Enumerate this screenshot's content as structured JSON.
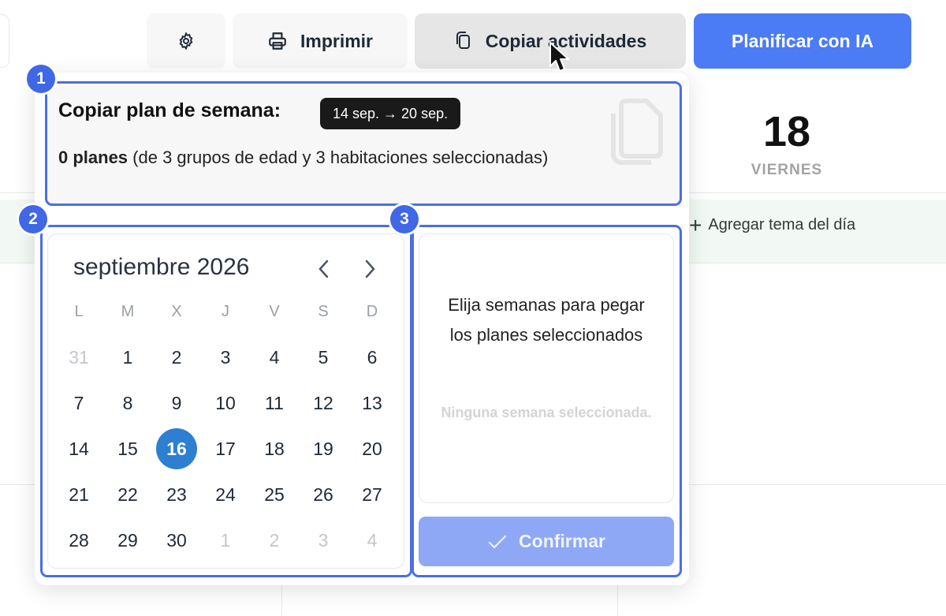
{
  "toolbar": {
    "print_label": "Imprimir",
    "copy_label": "Copiar actividades",
    "ai_label": "Planificar con IA"
  },
  "background": {
    "day_number": "18",
    "day_name": "VIERNES",
    "add_theme_label": "Agregar tema del día"
  },
  "badges": [
    "1",
    "2",
    "3"
  ],
  "copy_plan": {
    "title": "Copiar plan de semana:",
    "range": "14 sep. → 20 sep.",
    "count_bold": "0 planes",
    "count_rest": "(de 3 grupos de edad y 3 habitaciones seleccionadas)"
  },
  "calendar": {
    "month": "septiembre 2026",
    "weekdays": [
      "L",
      "M",
      "X",
      "J",
      "V",
      "S",
      "D"
    ],
    "days": [
      {
        "d": "31",
        "muted": true
      },
      {
        "d": "1"
      },
      {
        "d": "2"
      },
      {
        "d": "3"
      },
      {
        "d": "4"
      },
      {
        "d": "5"
      },
      {
        "d": "6"
      },
      {
        "d": "7"
      },
      {
        "d": "8"
      },
      {
        "d": "9"
      },
      {
        "d": "10"
      },
      {
        "d": "11"
      },
      {
        "d": "12"
      },
      {
        "d": "13"
      },
      {
        "d": "14"
      },
      {
        "d": "15"
      },
      {
        "d": "16",
        "today": true
      },
      {
        "d": "17"
      },
      {
        "d": "18"
      },
      {
        "d": "19"
      },
      {
        "d": "20"
      },
      {
        "d": "21"
      },
      {
        "d": "22"
      },
      {
        "d": "23"
      },
      {
        "d": "24"
      },
      {
        "d": "25"
      },
      {
        "d": "26"
      },
      {
        "d": "27"
      },
      {
        "d": "28"
      },
      {
        "d": "29"
      },
      {
        "d": "30"
      },
      {
        "d": "1",
        "muted": true
      },
      {
        "d": "2",
        "muted": true
      },
      {
        "d": "3",
        "muted": true
      },
      {
        "d": "4",
        "muted": true
      }
    ]
  },
  "paste_panel": {
    "instruction": "Elija semanas para pegar los planes seleccionados",
    "empty": "Ninguna semana seleccionada.",
    "confirm_label": "Confirmar"
  },
  "colors": {
    "accent": "#4b7bf5",
    "highlight": "#4a6ee6",
    "today": "#2d7fd1",
    "confirm_disabled": "#8ea8f6"
  }
}
